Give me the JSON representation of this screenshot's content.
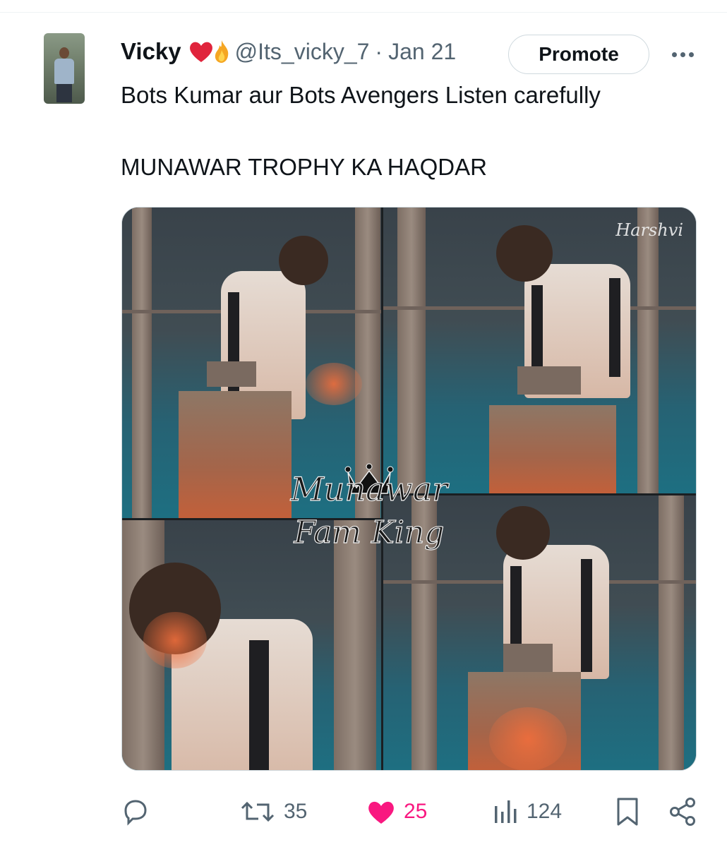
{
  "tweet": {
    "author_name": "Vicky",
    "handle": "@Its_vicky_7",
    "separator": "·",
    "date": "Jan 21",
    "promote_label": "Promote",
    "text_line_1": "Bots Kumar aur Bots Avengers Listen carefully",
    "text_line_2": "MUNAWAR TROPHY KA HAQDAR",
    "media": {
      "watermark_corner": "Harshvi",
      "watermark_line_1": "Munawar",
      "watermark_line_2": "Fam King"
    }
  },
  "actions": {
    "replies": "",
    "retweets": "35",
    "likes": "25",
    "views": "124"
  },
  "colors": {
    "text_primary": "#0f1419",
    "text_secondary": "#536471",
    "like_active": "#f91880",
    "border": "#cfd9de"
  },
  "icons": [
    "reply-icon",
    "retweet-icon",
    "heart-icon",
    "views-icon",
    "bookmark-icon",
    "share-icon",
    "more-icon"
  ]
}
